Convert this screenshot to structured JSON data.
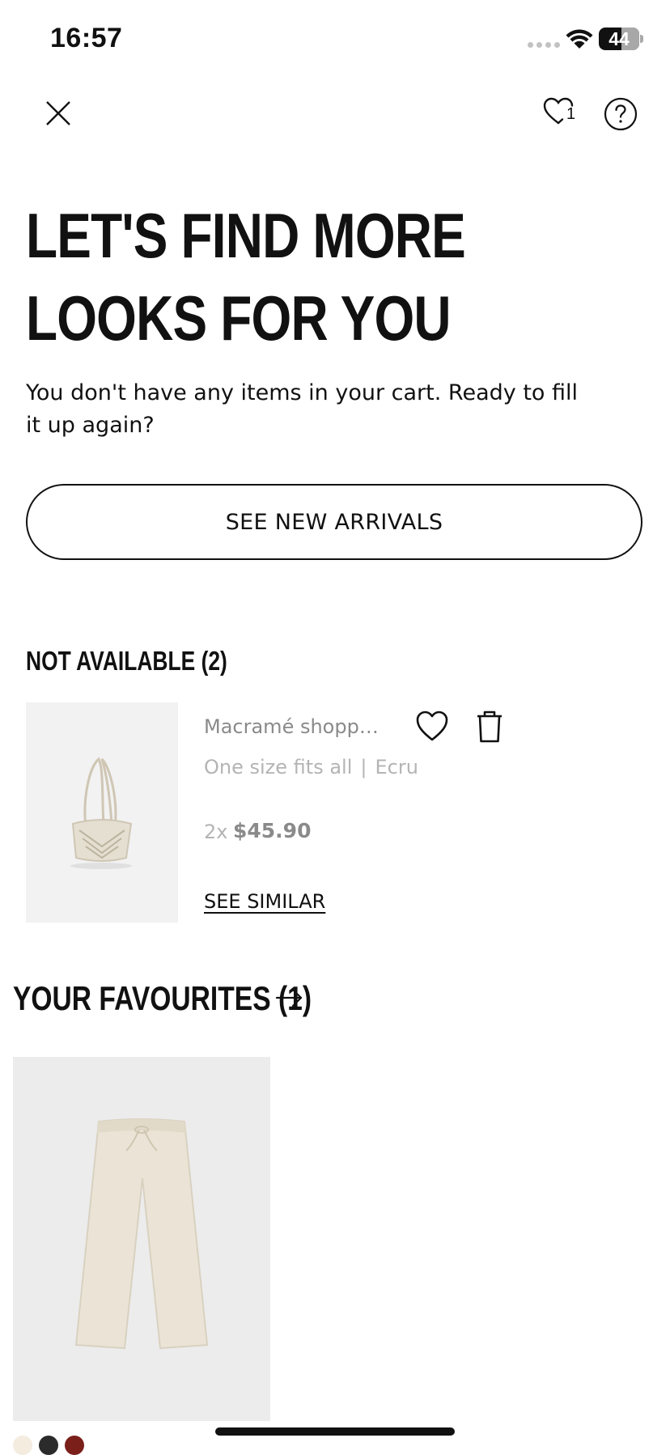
{
  "status_bar": {
    "time": "16:57",
    "battery": "44"
  },
  "toolbar": {
    "favourites_count": "1"
  },
  "empty_cart": {
    "headline": "LET'S FIND MORE LOOKS FOR YOU",
    "message": "You don't have any items in your cart. Ready to fill it up again?",
    "cta_label": "SEE NEW ARRIVALS"
  },
  "not_available": {
    "title": "NOT AVAILABLE (2)",
    "items": [
      {
        "name": "Macramé shopper...",
        "size": "One size fits all",
        "separator": "|",
        "color": "Ecru",
        "quantity": "2x",
        "price": "$45.90",
        "link_label": "SEE SIMILAR"
      }
    ]
  },
  "favourites": {
    "title": "YOUR FAVOURITES (1)",
    "swatch_colors": [
      "#f3ecdf",
      "#2b2b2b",
      "#7a1f1a"
    ]
  },
  "icons": {
    "close": "close-icon",
    "favourites": "heart-icon",
    "help": "question-icon",
    "wishlist": "heart-outline-icon",
    "delete": "trash-icon",
    "arrow": "arrow-right-icon"
  }
}
